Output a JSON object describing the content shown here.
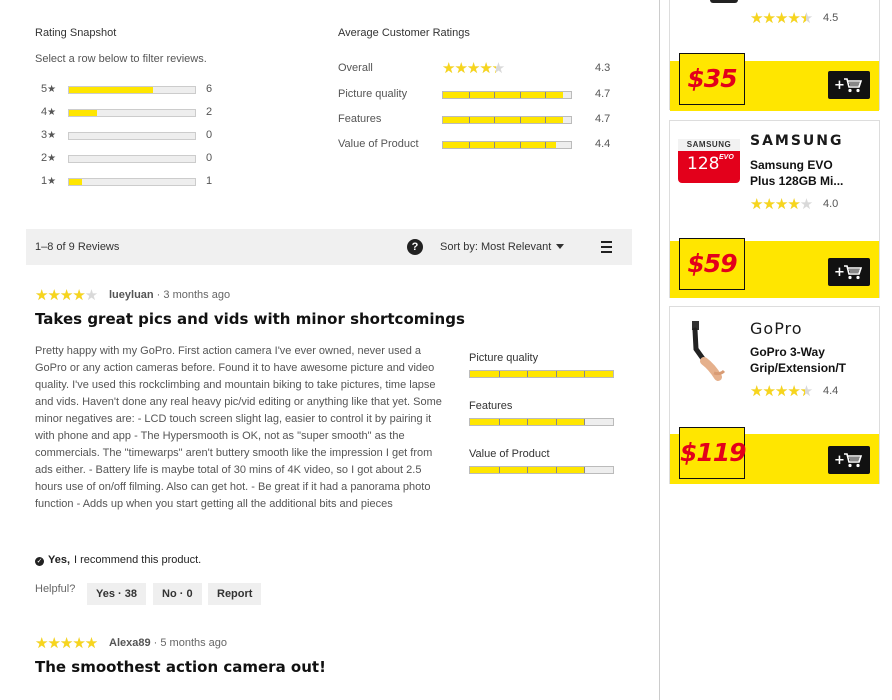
{
  "snapshot": {
    "title": "Rating Snapshot",
    "subtitle": "Select a row below to filter reviews.",
    "rows": [
      {
        "stars": "5",
        "fraction": 0.67,
        "count": "6"
      },
      {
        "stars": "4",
        "fraction": 0.22,
        "count": "2"
      },
      {
        "stars": "3",
        "fraction": 0,
        "count": "0"
      },
      {
        "stars": "2",
        "fraction": 0,
        "count": "0"
      },
      {
        "stars": "1",
        "fraction": 0.1,
        "count": "1"
      }
    ],
    "star_glyph": "★"
  },
  "average": {
    "title": "Average Customer Ratings",
    "overall_label": "Overall",
    "overall_value": "4.3",
    "overall_rating": 4.3,
    "rows": [
      {
        "label": "Picture quality",
        "value": "4.7",
        "rating": 4.7
      },
      {
        "label": "Features",
        "value": "4.7",
        "rating": 4.7
      },
      {
        "label": "Value of Product",
        "value": "4.4",
        "rating": 4.4
      }
    ]
  },
  "toolbar": {
    "count": "1–8 of 9 Reviews",
    "help": "?",
    "sort_label": "Sort by: Most Relevant"
  },
  "reviews": [
    {
      "rating": 4,
      "author": "lueyluan",
      "age": " · 3 months ago",
      "title": "Takes great pics and vids with minor shortcomings",
      "body": "Pretty happy with my GoPro. First action camera I've ever owned, never used a GoPro or any action cameras before. Found it to have awesome picture and video quality. I've used this rockclimbing and mountain biking to take pictures, time lapse and vids. Haven't done any real heavy pic/vid editing or anything like that yet. Some minor negatives are: - LCD touch screen slight lag, easier to control it by pairing it with phone and app - The Hypersmooth is OK, not as \"super smooth\" as the commercials. The \"timewarps\" aren't buttery smooth like the impression I get from ads either. - Battery life is maybe total of 30 mins of 4K video, so I got about 2.5 hours use of on/off filming. Also can get hot. - Be great if it had a panorama photo function - Adds up when you start getting all the additional bits and pieces",
      "subratings": [
        {
          "label": "Picture quality",
          "rating": 5
        },
        {
          "label": "Features",
          "rating": 4
        },
        {
          "label": "Value of Product",
          "rating": 4
        }
      ],
      "recommend_yes": "Yes,",
      "recommend_text": "I recommend this product.",
      "helpful_label": "Helpful?",
      "yes_btn": "Yes · 38",
      "no_btn": "No · 0",
      "report_btn": "Report"
    },
    {
      "rating": 5,
      "author": "Alexa89",
      "age": " · 5 months ago",
      "title": "The smoothest action camera out!"
    }
  ],
  "sidebar": {
    "products": [
      {
        "price": "$35",
        "rating_value": "4.5",
        "rating": 4.5
      },
      {
        "brand": "SAMSUNG",
        "name_line1": "Samsung EVO",
        "name_line2": "Plus 128GB Mi...",
        "rating_value": "4.0",
        "rating": 4.0,
        "price": "$59",
        "card_brand_text": "SAMSUNG",
        "card_capacity": "128",
        "card_evo": "EVO"
      },
      {
        "brand": "GoPro",
        "name_line1": "GoPro 3-Way",
        "name_line2": "Grip/Extension/T",
        "rating_value": "4.4",
        "rating": 4.4,
        "price": "$119"
      }
    ],
    "cart_plus": "+"
  },
  "colors": {
    "accent_yellow": "#ffe600",
    "price_red": "#e3001b",
    "star_yellow": "#f7d51d"
  }
}
